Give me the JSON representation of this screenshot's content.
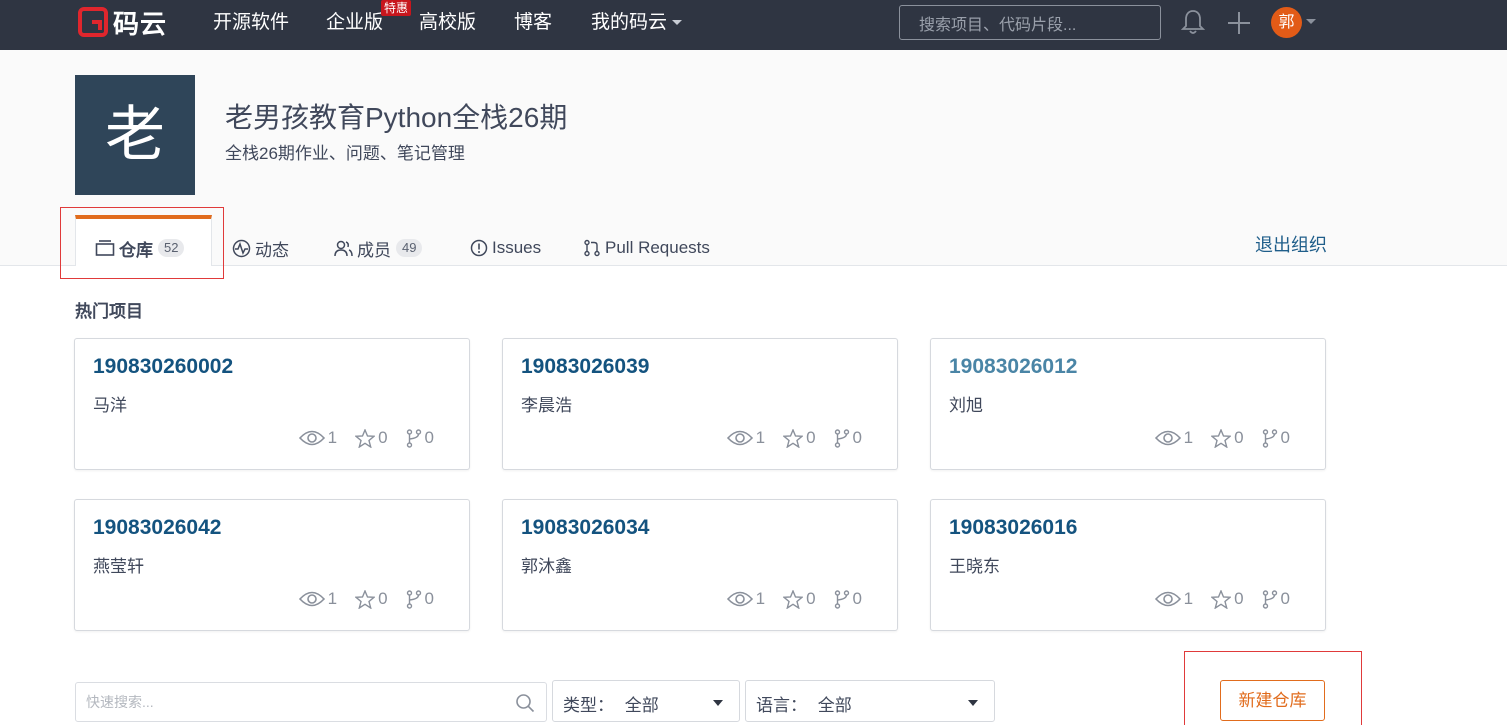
{
  "nav": {
    "logo_text": "码云",
    "items": [
      "开源软件",
      "企业版",
      "高校版",
      "博客",
      "我的码云"
    ],
    "badge": "特惠",
    "search_placeholder": "搜索项目、代码片段...",
    "avatar_text": "郭"
  },
  "org": {
    "avatar_char": "老",
    "title": "老男孩教育Python全栈26期",
    "description": "全栈26期作业、问题、笔记管理"
  },
  "tabs": [
    {
      "label": "仓库",
      "count": "52"
    },
    {
      "label": "动态"
    },
    {
      "label": "成员",
      "count": "49"
    },
    {
      "label": "Issues"
    },
    {
      "label": "Pull Requests"
    }
  ],
  "quit_org_label": "退出组织",
  "hot_projects_title": "热门项目",
  "projects": [
    {
      "name": "190830260002",
      "owner": "马洋",
      "watch": "1",
      "star": "0",
      "fork": "0"
    },
    {
      "name": "19083026039",
      "owner": "李晨浩",
      "watch": "1",
      "star": "0",
      "fork": "0"
    },
    {
      "name": "19083026012",
      "owner": "刘旭",
      "watch": "1",
      "star": "0",
      "fork": "0"
    },
    {
      "name": "19083026042",
      "owner": "燕莹轩",
      "watch": "1",
      "star": "0",
      "fork": "0"
    },
    {
      "name": "19083026034",
      "owner": "郭沐鑫",
      "watch": "1",
      "star": "0",
      "fork": "0"
    },
    {
      "name": "19083026016",
      "owner": "王晓东",
      "watch": "1",
      "star": "0",
      "fork": "0"
    }
  ],
  "filters": {
    "search_placeholder": "快速搜索...",
    "type_label": "类型：",
    "type_value": "全部",
    "lang_label": "语言：",
    "lang_value": "全部"
  },
  "new_repo_label": "新建仓库",
  "colors": {
    "nav_bg": "#2f3542",
    "accent": "#e16c1d",
    "link": "#14537f",
    "logo_red": "#c7161d"
  }
}
